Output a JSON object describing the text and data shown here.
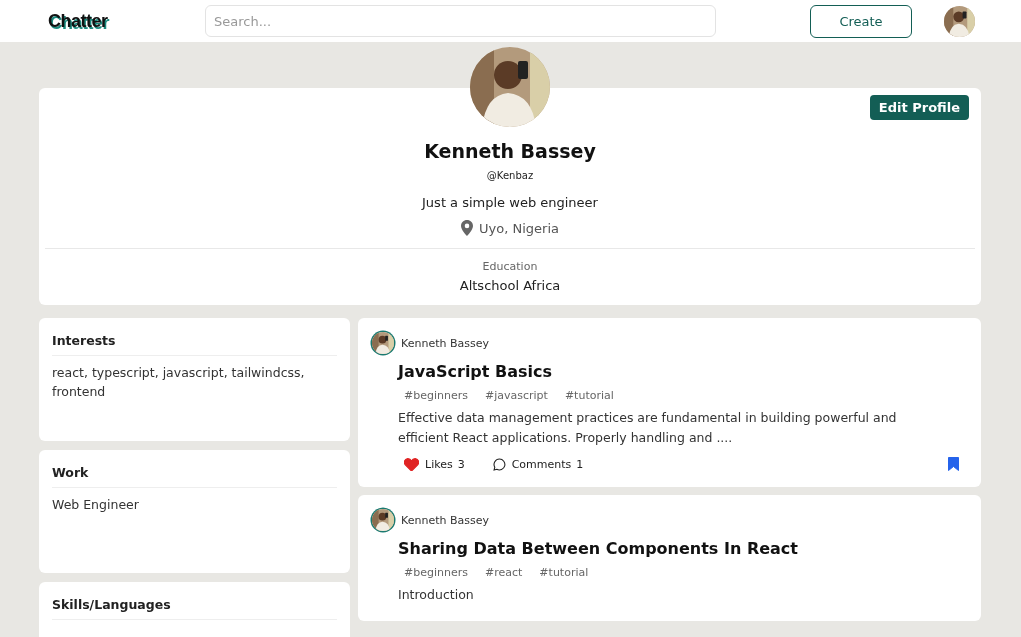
{
  "header": {
    "logo": "Chatter",
    "search": {
      "placeholder": "Search..."
    },
    "create_button": "Create"
  },
  "profile": {
    "edit_button": "Edit Profile",
    "name": "Kenneth Bassey",
    "handle": "@Kenbaz",
    "bio": "Just a simple web engineer",
    "location": "Uyo, Nigeria",
    "education_label": "Education",
    "education": "Altschool Africa"
  },
  "sidebar": [
    {
      "title": "Interests",
      "body": "react, typescript, javascript, tailwindcss, frontend"
    },
    {
      "title": "Work",
      "body": "Web Engineer"
    },
    {
      "title": "Skills/Languages"
    }
  ],
  "posts": [
    {
      "author": "Kenneth Bassey",
      "title": "JavaScript Basics",
      "tags": [
        "#beginners",
        "#javascript",
        "#tutorial"
      ],
      "excerpt": "Effective data management practices are fundamental in building powerful and efficient React applications. Properly handling and ....",
      "likes_label": "Likes",
      "likes": "3",
      "liked": true,
      "comments_label": "Comments",
      "comments": "1",
      "bookmarked": true
    },
    {
      "author": "Kenneth Bassey",
      "title": "Sharing Data Between Components In React",
      "tags": [
        "#beginners",
        "#react",
        "#tutorial"
      ],
      "excerpt": "Introduction"
    }
  ]
}
